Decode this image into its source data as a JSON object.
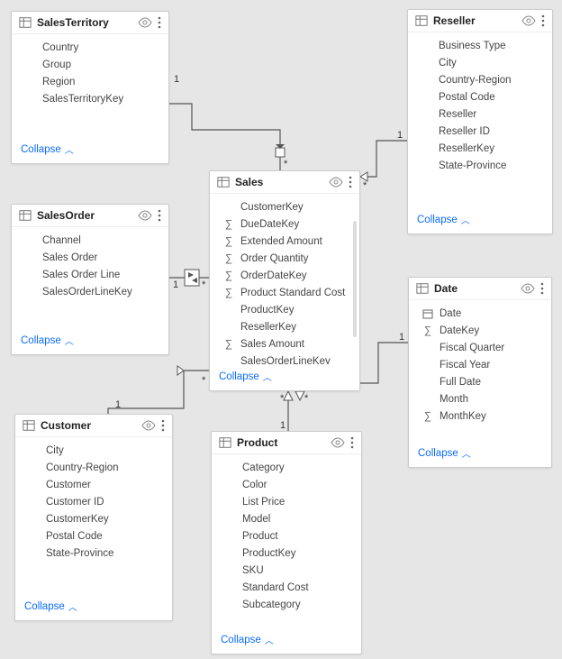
{
  "collapse_label": "Collapse",
  "tables": {
    "salesTerritory": {
      "title": "SalesTerritory",
      "fields": [
        {
          "label": "Country"
        },
        {
          "label": "Group"
        },
        {
          "label": "Region"
        },
        {
          "label": "SalesTerritoryKey"
        }
      ]
    },
    "reseller": {
      "title": "Reseller",
      "fields": [
        {
          "label": "Business Type"
        },
        {
          "label": "City"
        },
        {
          "label": "Country-Region"
        },
        {
          "label": "Postal Code"
        },
        {
          "label": "Reseller"
        },
        {
          "label": "Reseller ID"
        },
        {
          "label": "ResellerKey"
        },
        {
          "label": "State-Province"
        }
      ]
    },
    "salesOrder": {
      "title": "SalesOrder",
      "fields": [
        {
          "label": "Channel"
        },
        {
          "label": "Sales Order"
        },
        {
          "label": "Sales Order Line"
        },
        {
          "label": "SalesOrderLineKey"
        }
      ]
    },
    "sales": {
      "title": "Sales",
      "fields": [
        {
          "label": "CustomerKey"
        },
        {
          "label": "DueDateKey",
          "icon": "sigma"
        },
        {
          "label": "Extended Amount",
          "icon": "sigma"
        },
        {
          "label": "Order Quantity",
          "icon": "sigma"
        },
        {
          "label": "OrderDateKey",
          "icon": "sigma"
        },
        {
          "label": "Product Standard Cost",
          "icon": "sigma"
        },
        {
          "label": "ProductKey"
        },
        {
          "label": "ResellerKey"
        },
        {
          "label": "Sales Amount",
          "icon": "sigma"
        },
        {
          "label": "SalesOrderLineKey"
        }
      ]
    },
    "date": {
      "title": "Date",
      "fields": [
        {
          "label": "Date",
          "icon": "calendar"
        },
        {
          "label": "DateKey",
          "icon": "sigma"
        },
        {
          "label": "Fiscal Quarter"
        },
        {
          "label": "Fiscal Year"
        },
        {
          "label": "Full Date"
        },
        {
          "label": "Month"
        },
        {
          "label": "MonthKey",
          "icon": "sigma"
        }
      ]
    },
    "customer": {
      "title": "Customer",
      "fields": [
        {
          "label": "City"
        },
        {
          "label": "Country-Region"
        },
        {
          "label": "Customer"
        },
        {
          "label": "Customer ID"
        },
        {
          "label": "CustomerKey"
        },
        {
          "label": "Postal Code"
        },
        {
          "label": "State-Province"
        }
      ]
    },
    "product": {
      "title": "Product",
      "fields": [
        {
          "label": "Category"
        },
        {
          "label": "Color"
        },
        {
          "label": "List Price"
        },
        {
          "label": "Model"
        },
        {
          "label": "Product"
        },
        {
          "label": "ProductKey"
        },
        {
          "label": "SKU"
        },
        {
          "label": "Standard Cost"
        },
        {
          "label": "Subcategory"
        }
      ]
    }
  },
  "relationships": [
    {
      "from": "salesTerritory",
      "to": "sales",
      "from_card": "1",
      "to_card": "*"
    },
    {
      "from": "reseller",
      "to": "sales",
      "from_card": "1",
      "to_card": "*"
    },
    {
      "from": "salesOrder",
      "to": "sales",
      "from_card": "1",
      "to_card": "*",
      "bidirectional": true
    },
    {
      "from": "customer",
      "to": "sales",
      "from_card": "1",
      "to_card": "*"
    },
    {
      "from": "product",
      "to": "sales",
      "from_card": "1",
      "to_card": "*"
    },
    {
      "from": "date",
      "to": "sales",
      "from_card": "1",
      "to_card": "*"
    }
  ]
}
